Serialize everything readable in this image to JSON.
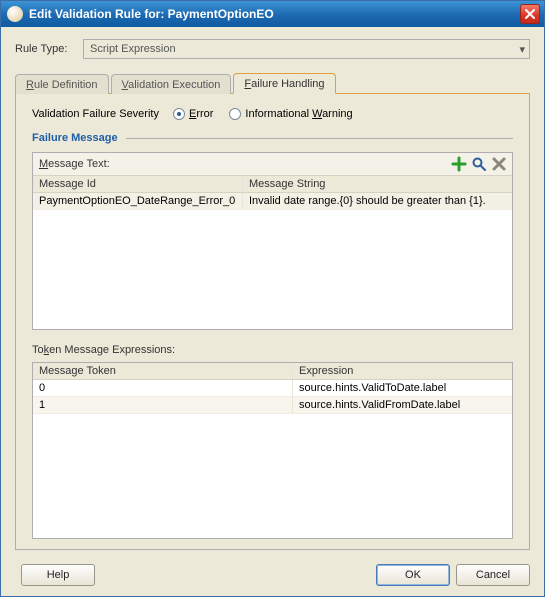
{
  "title": "Edit Validation Rule for: PaymentOptionEO",
  "rule_type_label": "Rule Type:",
  "rule_type_value": "Script Expression",
  "tabs": {
    "definition": "Rule Definition",
    "execution": "Validation Execution",
    "failure": "Failure Handling"
  },
  "severity": {
    "label": "Validation Failure Severity",
    "error": "Error",
    "warning": "Informational Warning",
    "selected": "error"
  },
  "failure_msg_group": "Failure Message",
  "message_text_label": "Message Text:",
  "message_table": {
    "headers": {
      "id": "Message Id",
      "string": "Message String"
    },
    "rows": [
      {
        "id": "PaymentOptionEO_DateRange_Error_0",
        "string": "Invalid date range.{0} should be greater than {1}."
      }
    ]
  },
  "token_label": "Token Message Expressions:",
  "token_table": {
    "headers": {
      "token": "Message Token",
      "expr": "Expression"
    },
    "rows": [
      {
        "token": "0",
        "expr": "source.hints.ValidToDate.label"
      },
      {
        "token": "1",
        "expr": "source.hints.ValidFromDate.label"
      }
    ]
  },
  "buttons": {
    "help": "Help",
    "ok": "OK",
    "cancel": "Cancel"
  },
  "icons": {
    "add": "add-icon",
    "search": "search-icon",
    "delete": "delete-icon"
  }
}
